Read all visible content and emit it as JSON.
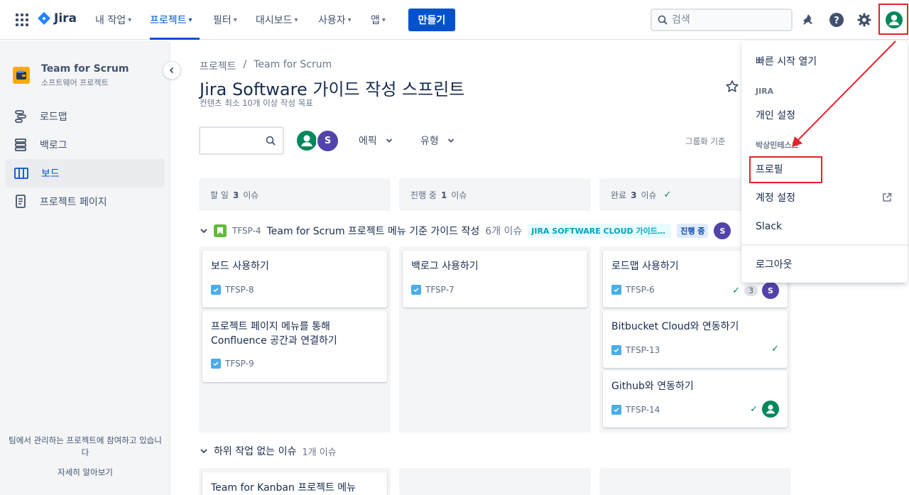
{
  "topnav": {
    "logo": "Jira",
    "items": [
      {
        "label": "내 작업"
      },
      {
        "label": "프로젝트"
      },
      {
        "label": "필터"
      },
      {
        "label": "대시보드"
      },
      {
        "label": "사용자"
      },
      {
        "label": "앱"
      }
    ],
    "create_label": "만들기",
    "search_placeholder": "검색"
  },
  "sidebar": {
    "project_name": "Team for Scrum",
    "project_type": "소프트웨어 프로젝트",
    "items": [
      {
        "label": "로드맵",
        "icon": "roadmap-icon"
      },
      {
        "label": "백로그",
        "icon": "backlog-icon"
      },
      {
        "label": "보드",
        "icon": "board-icon"
      },
      {
        "label": "프로젝트 페이지",
        "icon": "pages-icon"
      }
    ],
    "footer_text": "팀에서 관리하는 프로젝트에 참여하고 있습니다",
    "footer_link": "자세히 알아보기"
  },
  "main": {
    "breadcrumb": {
      "root": "프로젝트",
      "sep": "/",
      "project": "Team for Scrum"
    },
    "title": "Jira Software 가이드 작성 스프린트",
    "sprint_goal": "컨텐츠 최소 10개 이상 작성 목표",
    "filters": {
      "epic": "에픽",
      "type": "유형",
      "group_by": "그룹화 기준"
    },
    "avatar_letter": "S",
    "columns": [
      {
        "name": "할 일",
        "count": "3",
        "suffix": "이슈"
      },
      {
        "name": "진행 중",
        "count": "1",
        "suffix": "이슈"
      },
      {
        "name": "완료",
        "count": "3",
        "suffix": "이슈"
      }
    ],
    "swimlane": {
      "key": "TFSP-4",
      "title": "Team for Scrum 프로젝트 메뉴 기준 가이드 작성",
      "count": "6개 이슈",
      "epic": "JIRA SOFTWARE CLOUD 가이드 문서 작성",
      "status": "진행 중",
      "assignee": "S"
    },
    "cards": {
      "todo": [
        {
          "title": "보드 사용하기",
          "key": "TFSP-8"
        },
        {
          "title": "프로젝트 페이지 메뉴를 통해 Confluence 공간과 연결하기",
          "key": "TFSP-9"
        }
      ],
      "progress": [
        {
          "title": "백로그 사용하기",
          "key": "TFSP-7"
        }
      ],
      "done": [
        {
          "title": "로드맵 사용하기",
          "key": "TFSP-6",
          "count": "3",
          "assignee": "S"
        },
        {
          "title": "Bitbucket Cloud와 연동하기",
          "key": "TFSP-13"
        },
        {
          "title": "Github와 연동하기",
          "key": "TFSP-14"
        }
      ]
    },
    "swimlane2": {
      "title": "하위 작업 없는 이슈",
      "count": "1개 이슈"
    },
    "card_bottom": {
      "title": "Team for Kanban 프로젝트 메뉴"
    }
  },
  "profile_menu": {
    "quick_start": "빠른 시작 열기",
    "jira_heading": "JIRA",
    "personal_settings": "개인 설정",
    "user_heading": "박상민테스트",
    "profile": "프로필",
    "account_settings": "계정 설정",
    "slack": "Slack",
    "logout": "로그아웃"
  },
  "colors": {
    "accent": "#0052cc",
    "highlight": "#e5222b",
    "done": "#00875a"
  }
}
